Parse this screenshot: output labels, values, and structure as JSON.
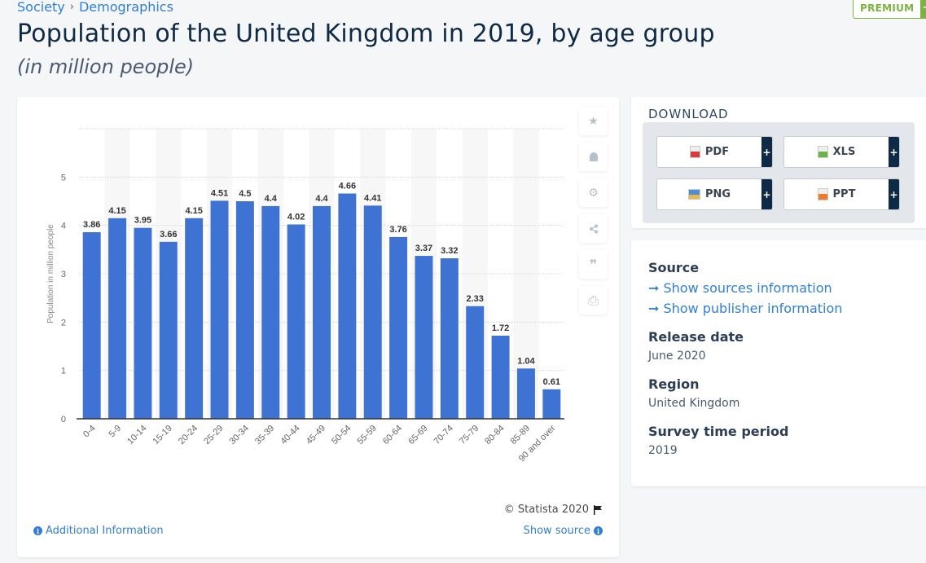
{
  "breadcrumb": {
    "items": [
      "Society",
      "Demographics"
    ],
    "separator": "›"
  },
  "premium": {
    "label": "PREMIUM",
    "plus": "+"
  },
  "header": {
    "title": "Population of the United Kingdom in 2019, by age group",
    "subtitle": "(in million people)"
  },
  "tools": [
    {
      "name": "star-icon",
      "glyph": "★"
    },
    {
      "name": "bell-icon",
      "glyph": "🔔"
    },
    {
      "name": "gear-icon",
      "glyph": "⚙"
    },
    {
      "name": "share-icon",
      "glyph": "⋖"
    },
    {
      "name": "quote-icon",
      "glyph": "❞"
    },
    {
      "name": "print-icon",
      "glyph": "⎙"
    }
  ],
  "chart_footer": {
    "copyright": "© Statista 2020",
    "additional_info": "Additional Information",
    "show_source": "Show source",
    "info_glyph": "i"
  },
  "download": {
    "title": "DOWNLOAD",
    "buttons": [
      {
        "label": "PDF",
        "color": "#d93a3a",
        "plus": "+"
      },
      {
        "label": "XLS",
        "color": "#6ab547",
        "plus": "+"
      },
      {
        "label": "PNG",
        "color": "#4a90d9",
        "plus": "+"
      },
      {
        "label": "PPT",
        "color": "#f07c2a",
        "plus": "+"
      }
    ]
  },
  "info": {
    "source_heading": "Source",
    "source_link": "➞ Show sources information",
    "publisher_link": "➞ Show publisher information",
    "release_heading": "Release date",
    "release_value": "June 2020",
    "region_heading": "Region",
    "region_value": "United Kingdom",
    "survey_heading": "Survey time period",
    "survey_value": "2019"
  },
  "colors": {
    "bar": "#3f73d3",
    "link": "#2f7ed8",
    "premium": "#7ab340",
    "navy": "#0f2a47"
  },
  "chart_data": {
    "type": "bar",
    "title": "Population of the United Kingdom in 2019, by age group",
    "subtitle": "(in million people)",
    "xlabel": "",
    "ylabel": "Population in million people",
    "categories": [
      "0-4",
      "5-9",
      "10-14",
      "15-19",
      "20-24",
      "25-29",
      "30-34",
      "35-39",
      "40-44",
      "45-49",
      "50-54",
      "55-59",
      "60-64",
      "65-69",
      "70-74",
      "75-79",
      "80-84",
      "85-89",
      "90 and over"
    ],
    "values": [
      3.86,
      4.15,
      3.95,
      3.66,
      4.15,
      4.51,
      4.5,
      4.4,
      4.02,
      4.4,
      4.66,
      4.41,
      3.76,
      3.37,
      3.32,
      2.33,
      1.72,
      1.04,
      0.61
    ],
    "yticks": [
      0,
      1,
      2,
      3,
      4,
      5
    ],
    "ylim": [
      0,
      6
    ],
    "grid": true,
    "legend": "none"
  }
}
